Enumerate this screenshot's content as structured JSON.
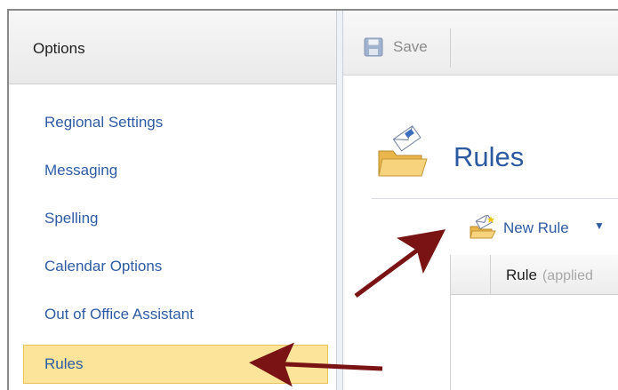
{
  "left_panel": {
    "title": "Options",
    "items": [
      {
        "label": "Regional Settings"
      },
      {
        "label": "Messaging"
      },
      {
        "label": "Spelling"
      },
      {
        "label": "Calendar Options"
      },
      {
        "label": "Out of Office Assistant"
      },
      {
        "label": "Rules",
        "selected": true
      }
    ]
  },
  "toolbar": {
    "save_label": "Save"
  },
  "main": {
    "title": "Rules",
    "new_rule_label": "New Rule",
    "grid": {
      "column_rule": "Rule",
      "column_rule_note": "(applied"
    }
  },
  "colors": {
    "link": "#2e5ca3",
    "title": "#2c5aa0",
    "selected_bg": "#fde49b",
    "annotation_arrow": "#7a1414"
  },
  "icons": {
    "save": "floppy-disk-icon",
    "rules": "folder-with-mail-icon",
    "new_rule": "folder-add-icon",
    "dropdown": "caret-down-icon"
  }
}
